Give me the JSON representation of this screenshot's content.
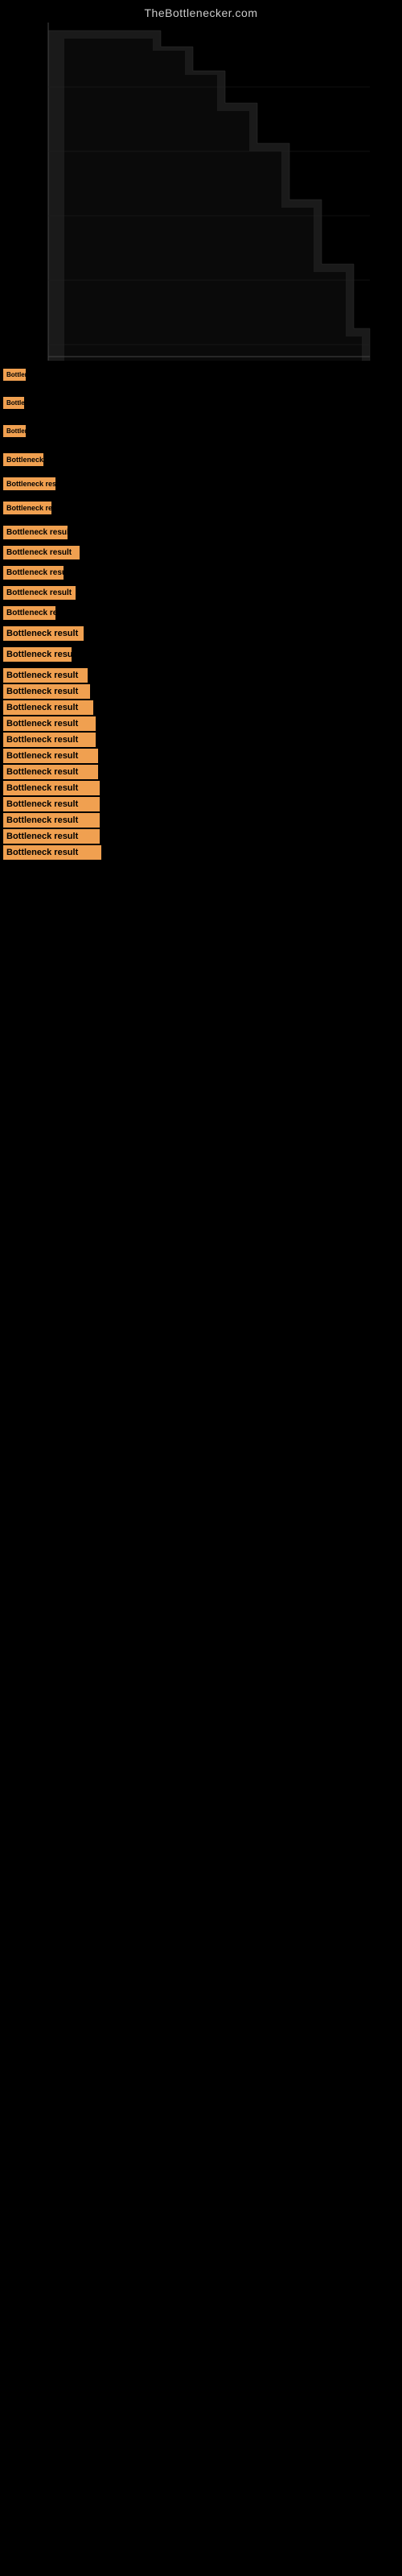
{
  "site": {
    "title": "TheBottlenecker.com"
  },
  "results": [
    {
      "id": 1,
      "label": "Bottleneck result",
      "display": "Bo",
      "gap": "xlarge"
    },
    {
      "id": 2,
      "label": "Bottleneck result",
      "display": "B",
      "gap": "xlarge"
    },
    {
      "id": 3,
      "label": "Bottleneck result",
      "display": "Bo",
      "gap": "xlarge"
    },
    {
      "id": 4,
      "label": "Bottleneck result",
      "display": "Bottlen",
      "gap": "large"
    },
    {
      "id": 5,
      "label": "Bottleneck result",
      "display": "Bottleneck r",
      "gap": "large"
    },
    {
      "id": 6,
      "label": "Bottleneck result",
      "display": "Bottlenec",
      "gap": "large"
    },
    {
      "id": 7,
      "label": "Bottleneck result",
      "display": "Bottleneck re",
      "gap": "medium"
    },
    {
      "id": 8,
      "label": "Bottleneck result",
      "display": "Bottleneck result",
      "gap": "medium"
    },
    {
      "id": 9,
      "label": "Bottleneck result",
      "display": "Bottleneck re",
      "gap": "medium"
    },
    {
      "id": 10,
      "label": "Bottleneck result",
      "display": "Bottleneck rest",
      "gap": "medium"
    },
    {
      "id": 11,
      "label": "Bottleneck result",
      "display": "Bottleneck",
      "gap": "medium"
    },
    {
      "id": 12,
      "label": "Bottleneck result",
      "display": "Bottleneck result",
      "gap": "medium"
    },
    {
      "id": 13,
      "label": "Bottleneck result",
      "display": "Bottleneck res",
      "gap": "medium"
    },
    {
      "id": 14,
      "label": "Bottleneck result",
      "display": "Bottleneck result",
      "gap": "small"
    },
    {
      "id": 15,
      "label": "Bottleneck result",
      "display": "Bottleneck result",
      "gap": "small"
    },
    {
      "id": 16,
      "label": "Bottleneck result",
      "display": "Bottleneck result",
      "gap": "small"
    },
    {
      "id": 17,
      "label": "Bottleneck result",
      "display": "Bottleneck result",
      "gap": "small"
    },
    {
      "id": 18,
      "label": "Bottleneck result",
      "display": "Bottleneck result",
      "gap": "small"
    },
    {
      "id": 19,
      "label": "Bottleneck result",
      "display": "Bottleneck result",
      "gap": "small"
    },
    {
      "id": 20,
      "label": "Bottleneck result",
      "display": "Bottleneck result",
      "gap": "small"
    },
    {
      "id": 21,
      "label": "Bottleneck result",
      "display": "Bottleneck result",
      "gap": "small"
    },
    {
      "id": 22,
      "label": "Bottleneck result",
      "display": "Bottleneck result",
      "gap": "small"
    },
    {
      "id": 23,
      "label": "Bottleneck result",
      "display": "Bottleneck result",
      "gap": "small"
    },
    {
      "id": 24,
      "label": "Bottleneck result",
      "display": "Bottleneck result",
      "gap": "small"
    },
    {
      "id": 25,
      "label": "Bottleneck result",
      "display": "Bottleneck result",
      "gap": "small"
    }
  ]
}
